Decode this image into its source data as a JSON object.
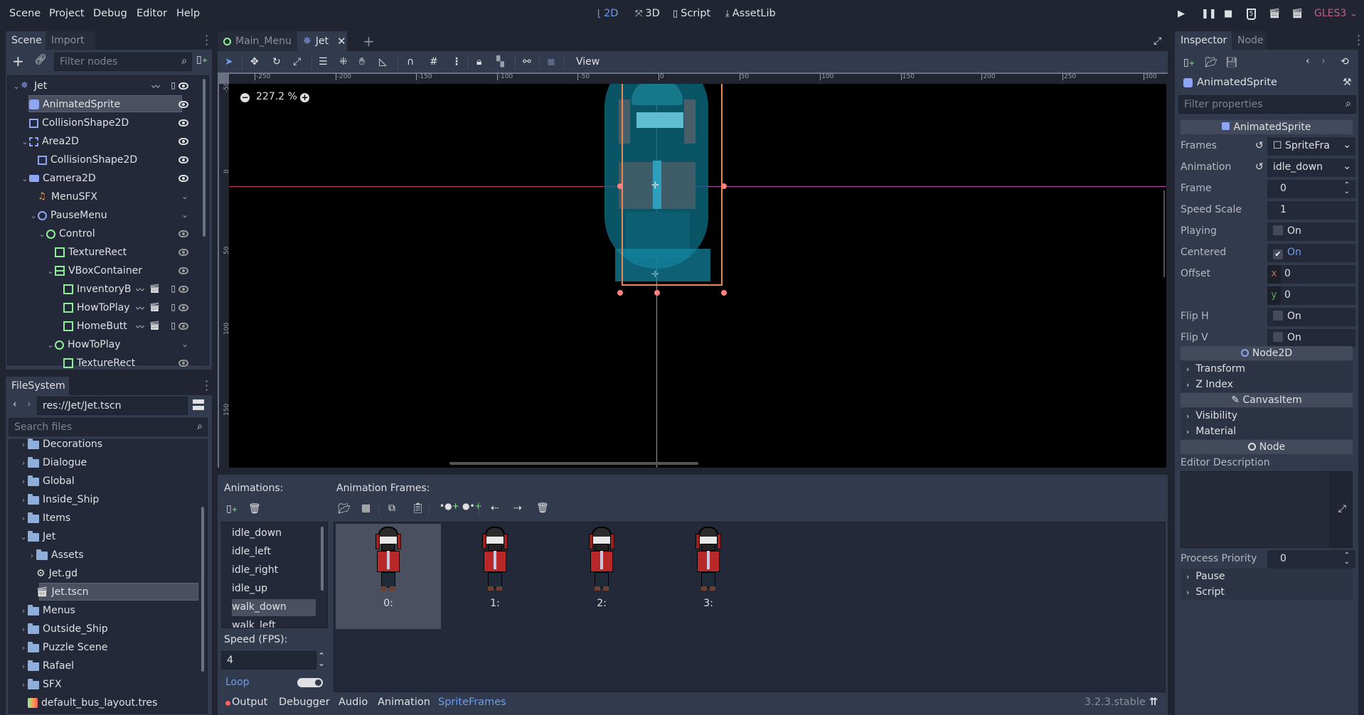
{
  "menubar": {
    "items": [
      "Scene",
      "Project",
      "Debug",
      "Editor",
      "Help"
    ],
    "workspaces": [
      {
        "label": "2D",
        "icon": "2d-axis-icon",
        "active": true
      },
      {
        "label": "3D",
        "icon": "3d-axis-icon",
        "active": false
      },
      {
        "label": "Script",
        "icon": "script-icon",
        "active": false
      },
      {
        "label": "AssetLib",
        "icon": "download-icon",
        "active": false
      }
    ],
    "renderer": "GLES3"
  },
  "scene_dock": {
    "tabs": [
      "Scene",
      "Import"
    ],
    "filter_placeholder": "Filter nodes",
    "tree": [
      {
        "label": "Jet",
        "depth": 0,
        "icon": "kinematic-body-icon",
        "expanded": true
      },
      {
        "label": "AnimatedSprite",
        "depth": 1,
        "icon": "animated-sprite-icon",
        "selected": true
      },
      {
        "label": "CollisionShape2D",
        "depth": 1,
        "icon": "collision-shape-icon"
      },
      {
        "label": "Area2D",
        "depth": 1,
        "icon": "area2d-icon",
        "expanded": true
      },
      {
        "label": "CollisionShape2D",
        "depth": 2,
        "icon": "collision-shape-icon"
      },
      {
        "label": "Camera2D",
        "depth": 1,
        "icon": "camera-icon",
        "expanded": true
      },
      {
        "label": "MenuSFX",
        "depth": 2,
        "icon": "audio-stream-icon"
      },
      {
        "label": "PauseMenu",
        "depth": 2,
        "icon": "node-icon",
        "expanded": true
      },
      {
        "label": "Control",
        "depth": 3,
        "icon": "control-icon",
        "expanded": true
      },
      {
        "label": "TextureRect",
        "depth": 4,
        "icon": "texture-rect-icon"
      },
      {
        "label": "VBoxContainer",
        "depth": 4,
        "icon": "vbox-icon",
        "expanded": true
      },
      {
        "label": "InventoryB",
        "depth": 5,
        "icon": "texture-button-icon"
      },
      {
        "label": "HowToPlay",
        "depth": 5,
        "icon": "texture-button-icon"
      },
      {
        "label": "HomeButt",
        "depth": 5,
        "icon": "texture-button-icon"
      },
      {
        "label": "HowToPlay",
        "depth": 4,
        "icon": "control-icon",
        "expanded": true
      },
      {
        "label": "TextureRect",
        "depth": 5,
        "icon": "texture-rect-icon"
      }
    ]
  },
  "filesystem": {
    "tab": "FileSystem",
    "path": "res://Jet/Jet.tscn",
    "search_placeholder": "Search files",
    "items": [
      {
        "label": "Decorations",
        "type": "folder",
        "depth": 1
      },
      {
        "label": "Dialogue",
        "type": "folder",
        "depth": 1
      },
      {
        "label": "Global",
        "type": "folder",
        "depth": 1
      },
      {
        "label": "Inside_Ship",
        "type": "folder",
        "depth": 1
      },
      {
        "label": "Items",
        "type": "folder",
        "depth": 1
      },
      {
        "label": "Jet",
        "type": "folder",
        "depth": 1,
        "expanded": true
      },
      {
        "label": "Assets",
        "type": "folder",
        "depth": 2
      },
      {
        "label": "Jet.gd",
        "type": "script",
        "depth": 2
      },
      {
        "label": "Jet.tscn",
        "type": "scene",
        "depth": 2,
        "selected": true
      },
      {
        "label": "Menus",
        "type": "folder",
        "depth": 1
      },
      {
        "label": "Outside_Ship",
        "type": "folder",
        "depth": 1
      },
      {
        "label": "Puzzle Scene",
        "type": "folder",
        "depth": 1
      },
      {
        "label": "Rafael",
        "type": "folder",
        "depth": 1
      },
      {
        "label": "SFX",
        "type": "folder",
        "depth": 1
      },
      {
        "label": "default_bus_layout.tres",
        "type": "audio-bus",
        "depth": 1
      }
    ]
  },
  "viewport": {
    "tabs": [
      {
        "label": "Main_Menu",
        "active": false
      },
      {
        "label": "Jet",
        "active": true
      }
    ],
    "view_menu": "View",
    "zoom": "227.2 %",
    "ruler_x": [
      "-250",
      "-200",
      "-150",
      "-100",
      "-50",
      "0",
      "50",
      "100",
      "150",
      "200",
      "250",
      "300"
    ],
    "ruler_y": [
      "-50",
      "0",
      "50",
      "100",
      "150"
    ]
  },
  "inspector": {
    "tabs": [
      "Inspector",
      "Node"
    ],
    "object_name": "AnimatedSprite",
    "filter_placeholder": "Filter properties",
    "class_header": "AnimatedSprite",
    "properties": {
      "frames": {
        "label": "Frames",
        "value": "SpriteFra"
      },
      "animation": {
        "label": "Animation",
        "value": "idle_down"
      },
      "frame": {
        "label": "Frame",
        "value": "0"
      },
      "speed_scale": {
        "label": "Speed Scale",
        "value": "1"
      },
      "playing": {
        "label": "Playing",
        "value": "On",
        "checked": false
      },
      "centered": {
        "label": "Centered",
        "value": "On",
        "checked": true
      },
      "offset": {
        "label": "Offset",
        "x": "0",
        "y": "0"
      },
      "flip_h": {
        "label": "Flip H",
        "value": "On",
        "checked": false
      },
      "flip_v": {
        "label": "Flip V",
        "value": "On",
        "checked": false
      }
    },
    "node2d_header": "Node2D",
    "node2d_groups": [
      "Transform",
      "Z Index"
    ],
    "canvasitem_header": "CanvasItem",
    "canvasitem_groups": [
      "Visibility",
      "Material"
    ],
    "node_header": "Node",
    "editor_description_label": "Editor Description",
    "process_priority": {
      "label": "Process Priority",
      "value": "0"
    },
    "node_groups": [
      "Pause",
      "Script"
    ]
  },
  "spriteframes": {
    "animations_label": "Animations:",
    "frames_label": "Animation Frames:",
    "animations": [
      "idle_down",
      "idle_left",
      "idle_right",
      "idle_up",
      "walk_down",
      "walk_left"
    ],
    "selected_animation": "walk_down",
    "speed_label": "Speed (FPS):",
    "speed_value": "4",
    "loop_label": "Loop",
    "loop_on": true,
    "frames": [
      "0:",
      "1:",
      "2:",
      "3:"
    ],
    "selected_frame": 0
  },
  "bottom_tabs": {
    "items": [
      "Output",
      "Debugger",
      "Audio",
      "Animation",
      "SpriteFrames"
    ],
    "active": "SpriteFrames",
    "version": "3.2.3.stable"
  },
  "colors": {
    "accent": "#6e9ee8",
    "renderer": "#c25e85",
    "output_dot": "#ff5d5d"
  }
}
